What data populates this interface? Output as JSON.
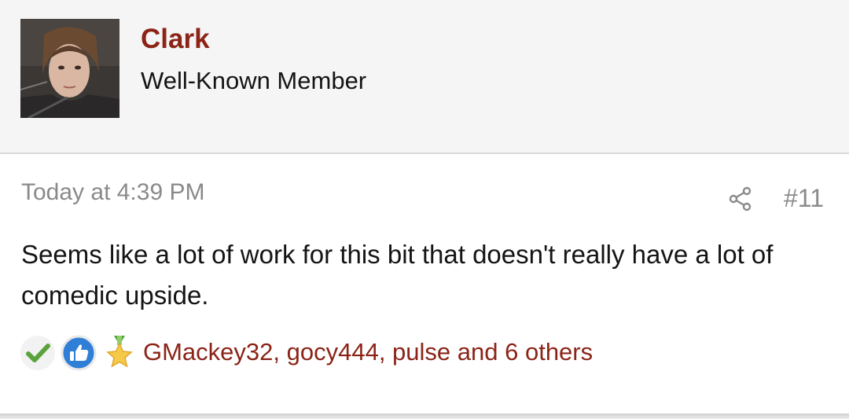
{
  "post": {
    "author": {
      "name": "Clark",
      "title": "Well-Known Member"
    },
    "time": "Today at 4:39 PM",
    "number": "#11",
    "body": "Seems like a lot of work for this bit that doesn't really have a lot of comedic upside.",
    "reactions": {
      "icons": [
        "check-icon",
        "like-icon",
        "star-medal-icon"
      ],
      "users_text": "GMackey32, gocy444, pulse and 6 others"
    }
  },
  "colors": {
    "accent": "#8b2417",
    "muted_text": "#8a8a8a",
    "header_bg": "#f5f5f5"
  }
}
